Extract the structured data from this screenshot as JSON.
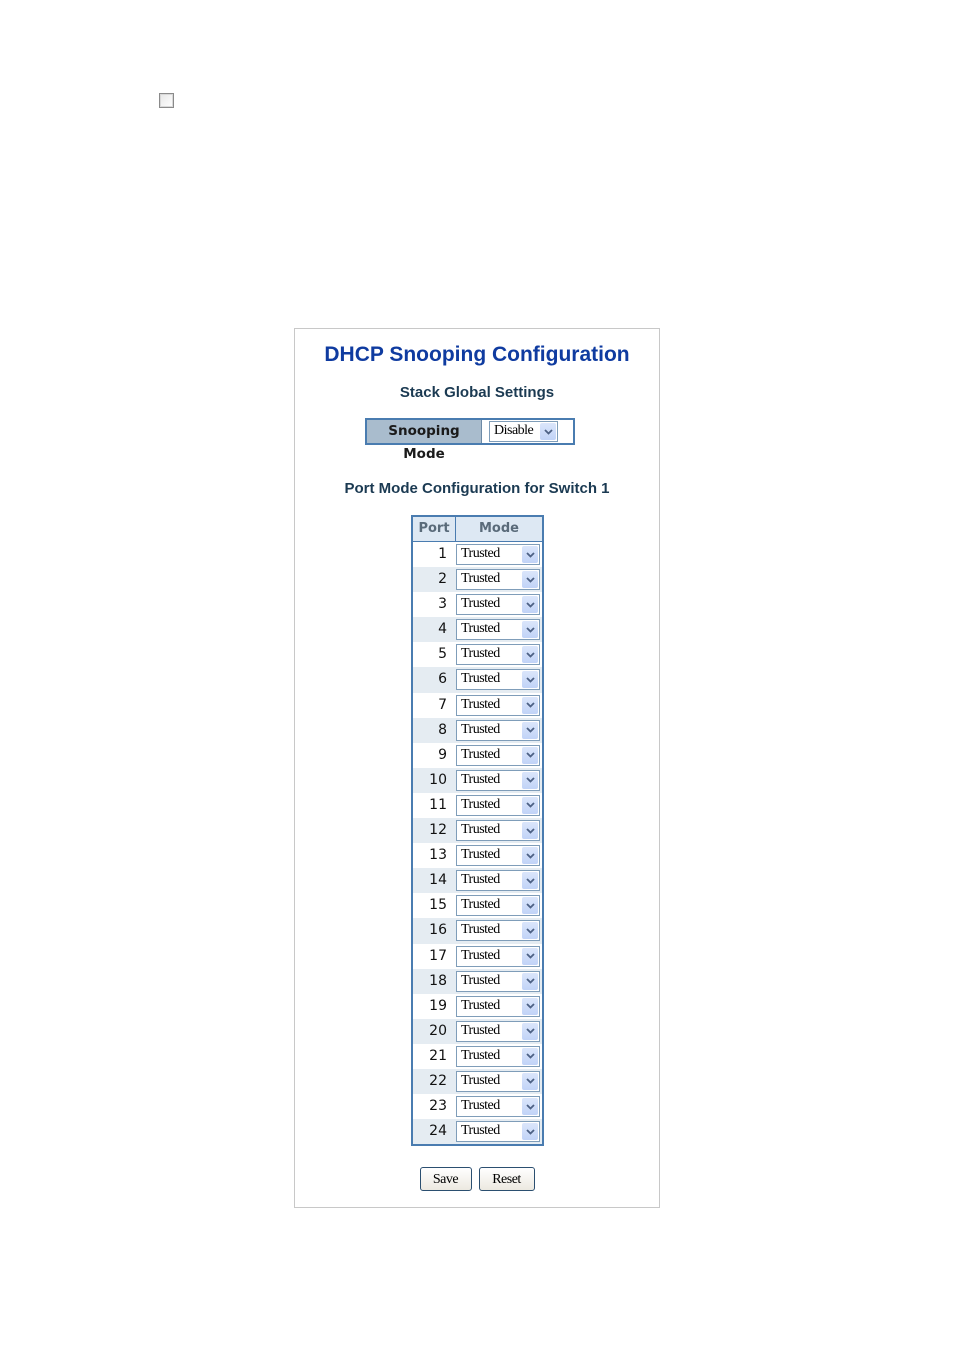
{
  "page": {
    "checkbox_checked": false
  },
  "panel": {
    "title": "DHCP Snooping Configuration",
    "global_heading": "Stack Global Settings",
    "snooping_mode": {
      "label": "Snooping Mode",
      "value": "Disable"
    },
    "port_heading": "Port Mode Configuration for Switch 1",
    "table": {
      "headers": [
        "Port",
        "Mode"
      ],
      "rows": [
        {
          "port": "1",
          "mode": "Trusted"
        },
        {
          "port": "2",
          "mode": "Trusted"
        },
        {
          "port": "3",
          "mode": "Trusted"
        },
        {
          "port": "4",
          "mode": "Trusted"
        },
        {
          "port": "5",
          "mode": "Trusted"
        },
        {
          "port": "6",
          "mode": "Trusted"
        },
        {
          "port": "7",
          "mode": "Trusted"
        },
        {
          "port": "8",
          "mode": "Trusted"
        },
        {
          "port": "9",
          "mode": "Trusted"
        },
        {
          "port": "10",
          "mode": "Trusted"
        },
        {
          "port": "11",
          "mode": "Trusted"
        },
        {
          "port": "12",
          "mode": "Trusted"
        },
        {
          "port": "13",
          "mode": "Trusted"
        },
        {
          "port": "14",
          "mode": "Trusted"
        },
        {
          "port": "15",
          "mode": "Trusted"
        },
        {
          "port": "16",
          "mode": "Trusted"
        },
        {
          "port": "17",
          "mode": "Trusted"
        },
        {
          "port": "18",
          "mode": "Trusted"
        },
        {
          "port": "19",
          "mode": "Trusted"
        },
        {
          "port": "20",
          "mode": "Trusted"
        },
        {
          "port": "21",
          "mode": "Trusted"
        },
        {
          "port": "22",
          "mode": "Trusted"
        },
        {
          "port": "23",
          "mode": "Trusted"
        },
        {
          "port": "24",
          "mode": "Trusted"
        }
      ]
    },
    "buttons": {
      "save": "Save",
      "reset": "Reset"
    }
  }
}
